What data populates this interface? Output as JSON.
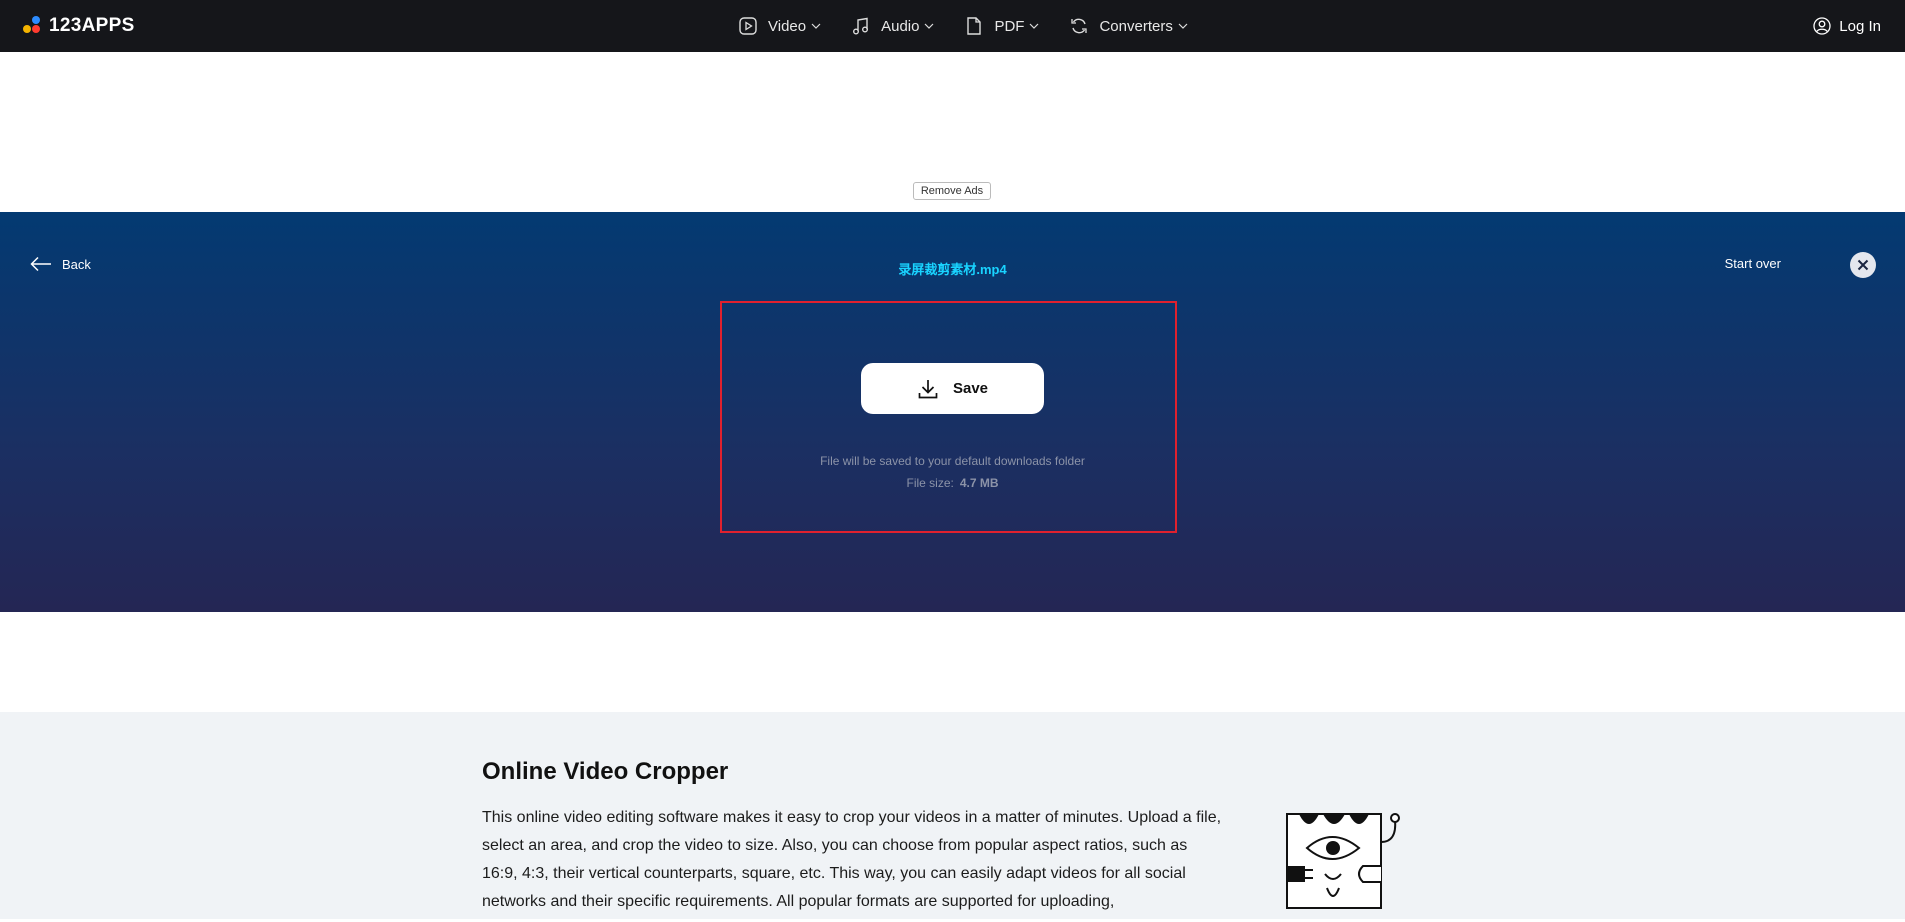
{
  "header": {
    "logo_text": "123APPS",
    "nav": [
      {
        "label": "Video",
        "icon": "video-play-icon"
      },
      {
        "label": "Audio",
        "icon": "music-note-icon"
      },
      {
        "label": "PDF",
        "icon": "document-icon"
      },
      {
        "label": "Converters",
        "icon": "refresh-icon"
      }
    ],
    "login_label": "Log In"
  },
  "ad": {
    "remove_ads_label": "Remove Ads"
  },
  "tool": {
    "back_label": "Back",
    "filename": "录屏裁剪素材.mp4",
    "start_over_label": "Start over",
    "save_label": "Save",
    "save_note": "File will be saved to your default downloads folder",
    "file_size_label": "File size:",
    "file_size_value": "4.7 MB"
  },
  "info": {
    "title": "Online Video Cropper",
    "text": "This online video editing software makes it easy to crop your videos in a matter of minutes. Upload a file, select an area, and crop the video to size. Also, you can choose from popular aspect ratios, such as 16:9, 4:3, their vertical counterparts, square, etc. This way, you can easily adapt videos for all social networks and their specific requirements. All popular formats are supported for uploading,"
  },
  "colors": {
    "topbar": "#15161a",
    "hero_top": "#033a72",
    "hero_bottom": "#242654",
    "filename": "#19d3ff",
    "highlight_border": "#e0212e",
    "info_bg": "#f0f3f6"
  }
}
